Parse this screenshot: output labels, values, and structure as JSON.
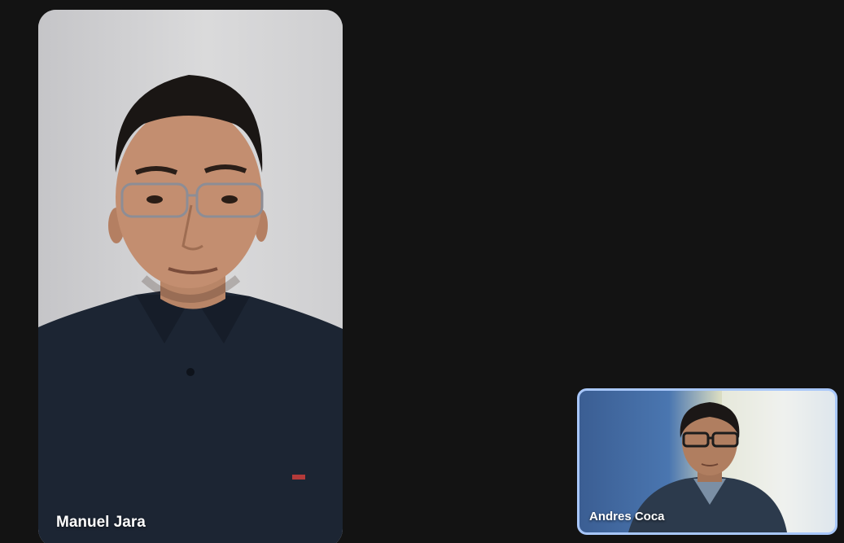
{
  "meeting": {
    "participants": [
      {
        "name": "Manuel Jara",
        "role": "remote"
      },
      {
        "name": "Andres Coca",
        "role": "self"
      }
    ]
  },
  "colors": {
    "background": "#131313",
    "self_tile_border": "#a8c7fa",
    "name_label": "#ffffff"
  }
}
